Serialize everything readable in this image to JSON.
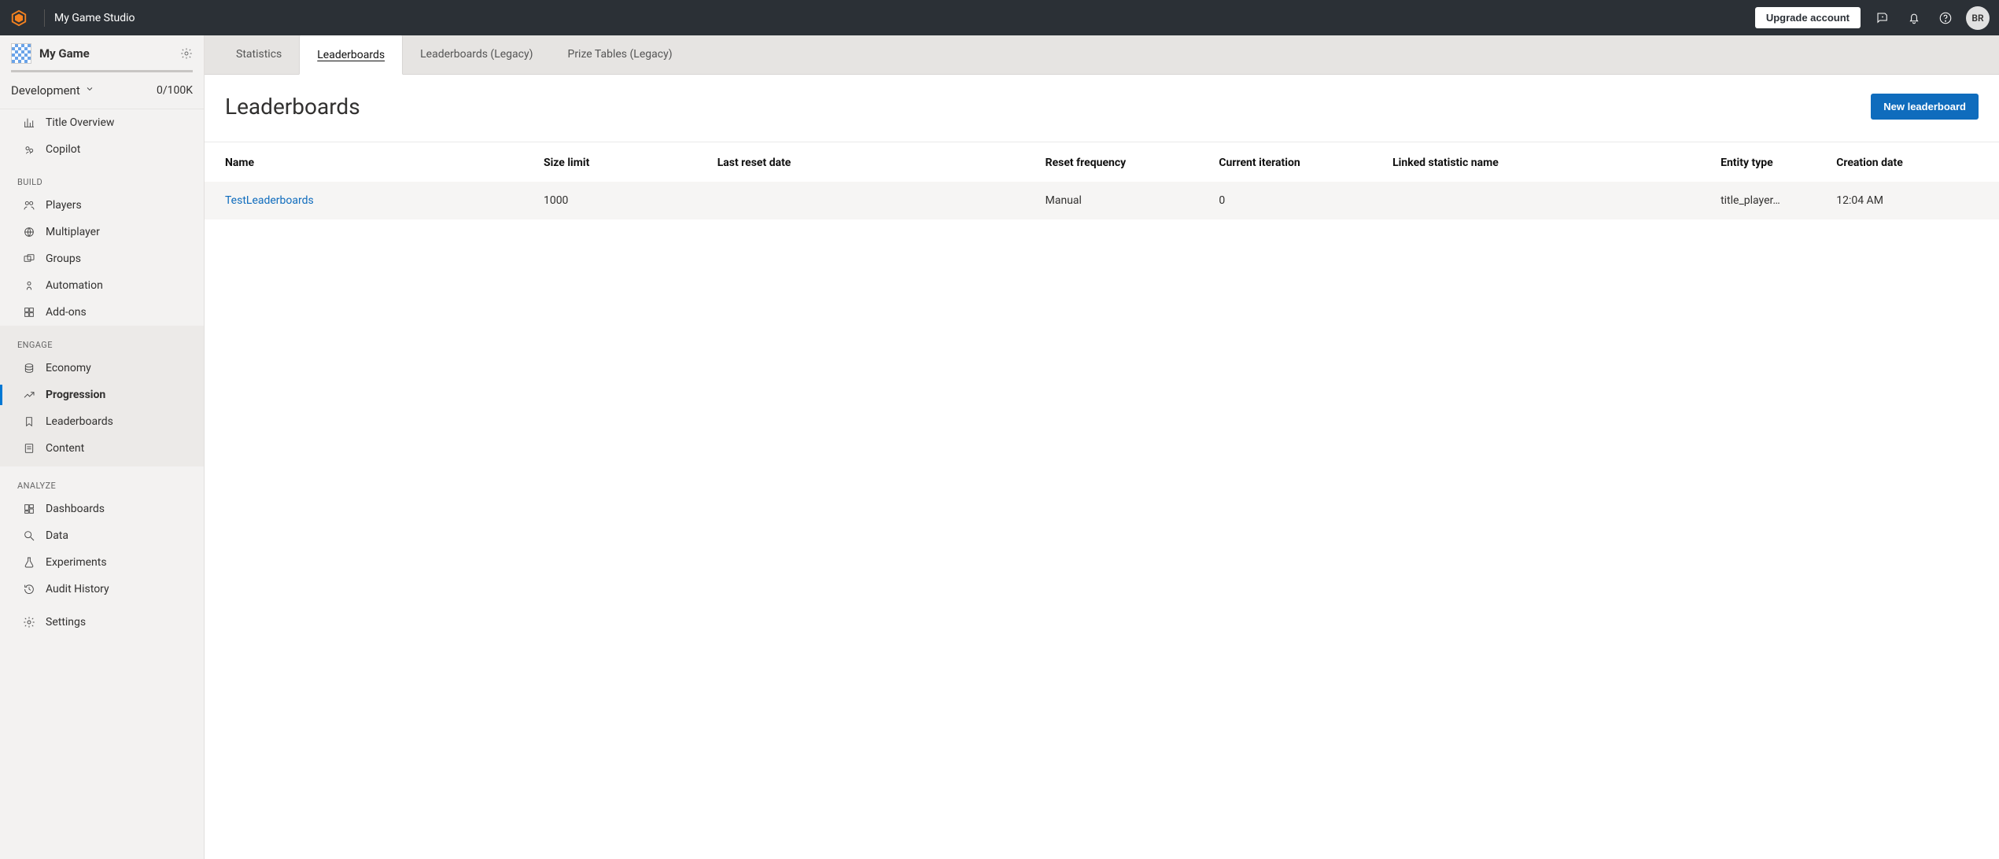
{
  "topbar": {
    "studio_name": "My Game Studio",
    "upgrade_label": "Upgrade account",
    "avatar_initials": "BR"
  },
  "sidebar": {
    "game_name": "My Game",
    "environment": "Development",
    "usage": "0/100K",
    "item_title_overview": "Title Overview",
    "item_copilot": "Copilot",
    "section_build": "BUILD",
    "item_players": "Players",
    "item_multiplayer": "Multiplayer",
    "item_groups": "Groups",
    "item_automation": "Automation",
    "item_addons": "Add-ons",
    "section_engage": "ENGAGE",
    "item_economy": "Economy",
    "item_progression": "Progression",
    "item_leaderboards": "Leaderboards",
    "item_content": "Content",
    "section_analyze": "ANALYZE",
    "item_dashboards": "Dashboards",
    "item_data": "Data",
    "item_experiments": "Experiments",
    "item_audit": "Audit History",
    "item_settings": "Settings"
  },
  "tabs": {
    "statistics": "Statistics",
    "leaderboards": "Leaderboards",
    "leaderboards_legacy": "Leaderboards (Legacy)",
    "prize_tables_legacy": "Prize Tables (Legacy)"
  },
  "page": {
    "title": "Leaderboards",
    "new_button": "New leaderboard"
  },
  "table": {
    "headers": {
      "name": "Name",
      "size_limit": "Size limit",
      "last_reset": "Last reset date",
      "reset_freq": "Reset frequency",
      "current_iter": "Current iteration",
      "linked_stat": "Linked statistic name",
      "entity_type": "Entity type",
      "creation_date": "Creation date"
    },
    "rows": [
      {
        "name": "TestLeaderboards",
        "size_limit": "1000",
        "last_reset": "",
        "reset_freq": "Manual",
        "current_iter": "0",
        "linked_stat": "",
        "entity_type": "title_player…",
        "creation_date": "12:04 AM"
      }
    ]
  }
}
